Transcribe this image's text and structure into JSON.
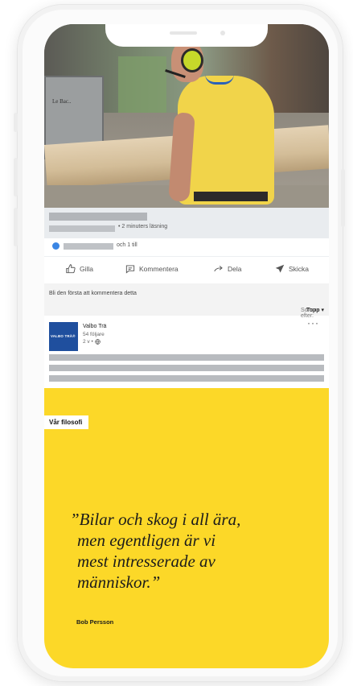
{
  "post": {
    "read_time": "• 2 minuters läsning",
    "reactions_text": "och 1 till"
  },
  "actions": [
    {
      "label": "Gilla",
      "icon": "thumbs-up-icon"
    },
    {
      "label": "Kommentera",
      "icon": "comment-icon"
    },
    {
      "label": "Dela",
      "icon": "share-arrow-icon"
    },
    {
      "label": "Skicka",
      "icon": "send-icon"
    }
  ],
  "comments": {
    "prompt": "Bli den första att kommentera detta",
    "sort_label": "Sortera efter:",
    "sort_value": "Topp ▾"
  },
  "comment_card": {
    "logo_text": "VALBO TRÄ®",
    "name": "Valbo Trä",
    "followers": "54 följare",
    "time": "2 v •",
    "more": "···"
  },
  "quote_panel": {
    "tag": "Vår filosofi",
    "quote_lines": [
      "”Bilar och skog i all ära,",
      "men egentligen är vi",
      "mest intresserade av",
      "människor.”"
    ],
    "author": "Bob Persson"
  },
  "colors": {
    "quote_bg": "#fcd828",
    "logo_bg": "#1f4f9e",
    "like_blue": "#3a86e4"
  }
}
